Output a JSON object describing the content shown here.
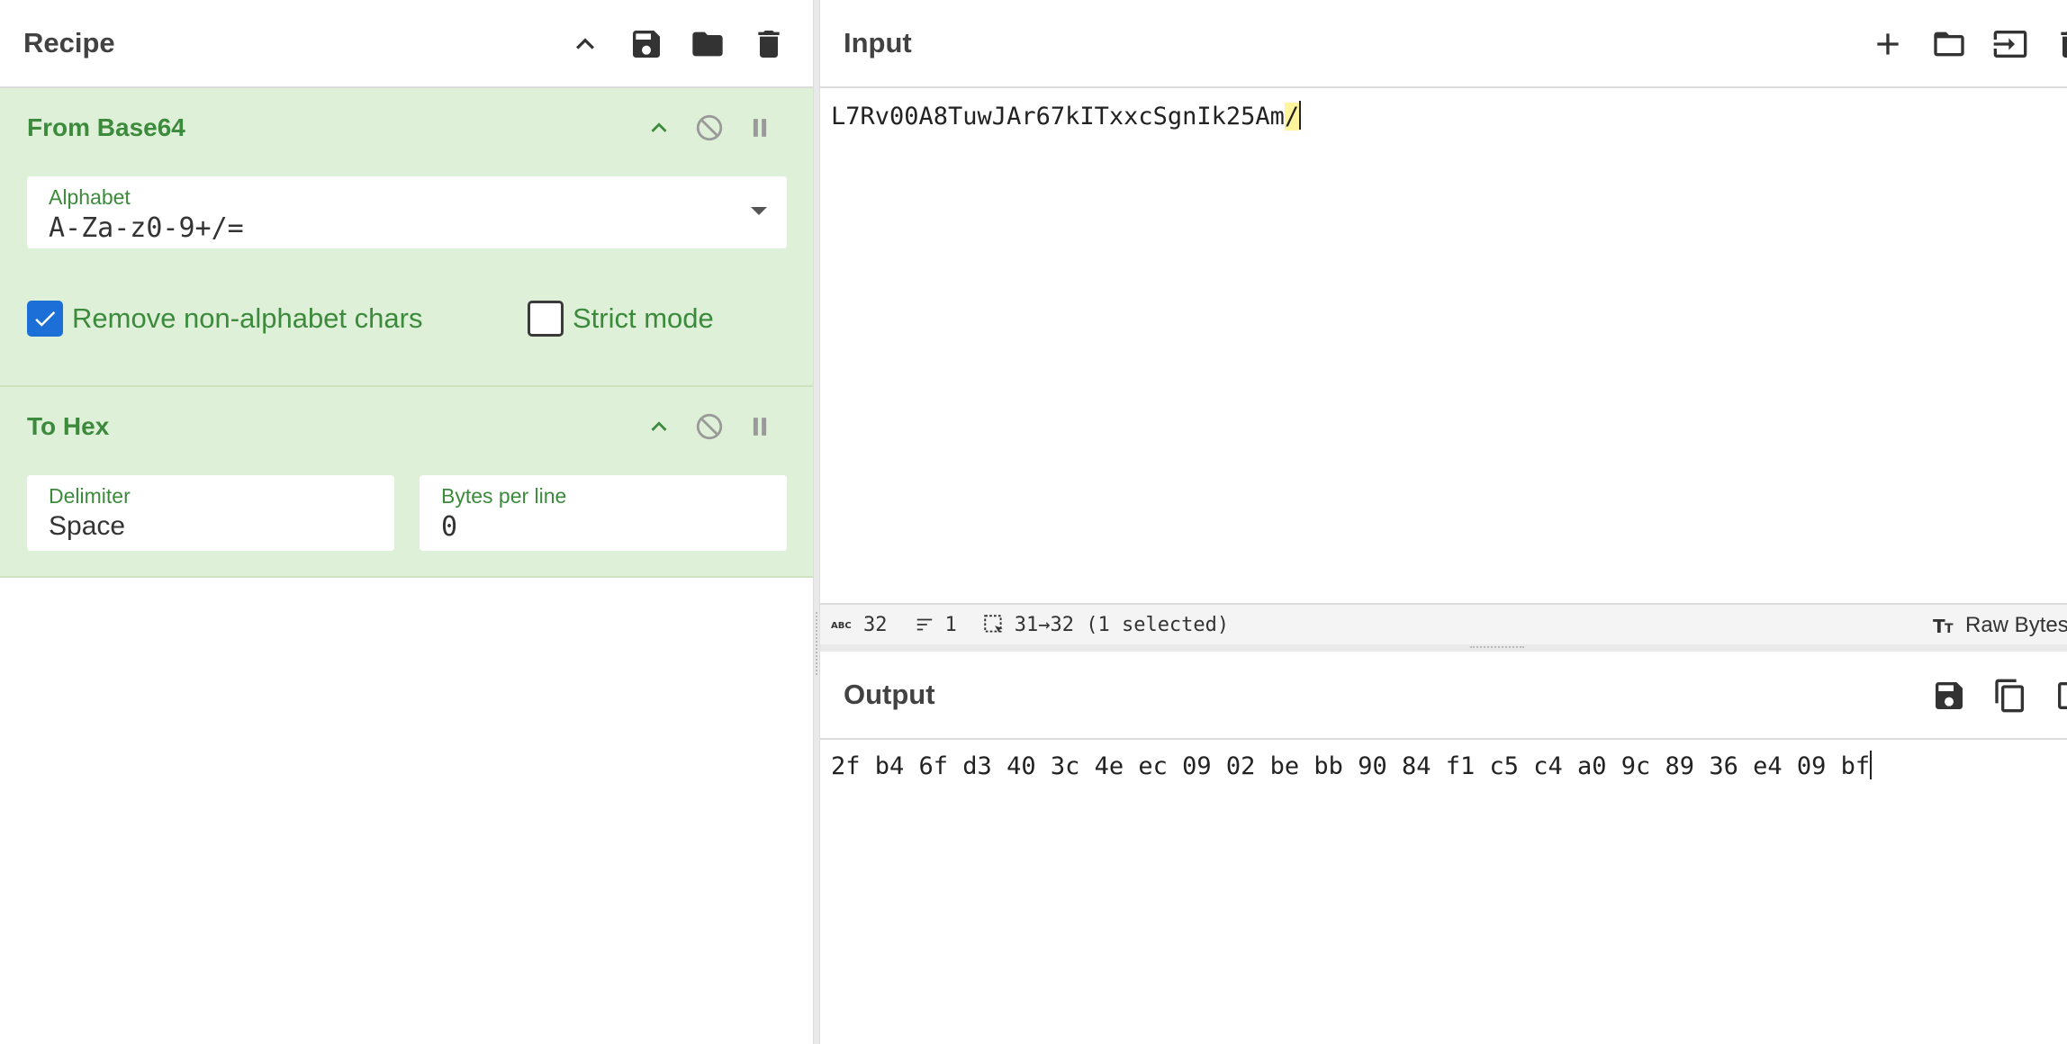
{
  "recipe": {
    "title": "Recipe",
    "header_icons": [
      "chevron-up-icon",
      "save-icon",
      "folder-icon",
      "trash-icon"
    ],
    "operations": [
      {
        "name": "From Base64",
        "alphabet_label": "Alphabet",
        "alphabet_value": "A-Za-z0-9+/=",
        "remove_non_alphabet_label": "Remove non-alphabet chars",
        "remove_non_alphabet_checked": true,
        "strict_mode_label": "Strict mode",
        "strict_mode_checked": false
      },
      {
        "name": "To Hex",
        "delimiter_label": "Delimiter",
        "delimiter_value": "Space",
        "bytes_per_line_label": "Bytes per line",
        "bytes_per_line_value": "0"
      }
    ]
  },
  "input": {
    "title": "Input",
    "text_before_selection": "L7Rv00A8TuwJAr67kITxxcSgnIk25Am",
    "text_selected": "/",
    "status": {
      "length": "32",
      "lines": "1",
      "selection": "31→32 (1 selected)",
      "encoding": "Raw Bytes"
    }
  },
  "output": {
    "title": "Output",
    "text": "2f b4 6f d3 40 3c 4e ec 09 02 be bb 90 84 f1 c5 c4 a0 9c 89 36 e4 09 bf"
  },
  "colors": {
    "operation_bg": "#dff0d8",
    "operation_text": "#3c8a3c",
    "checkbox_checked": "#1d6fd8",
    "selection_highlight": "#fff59d"
  }
}
